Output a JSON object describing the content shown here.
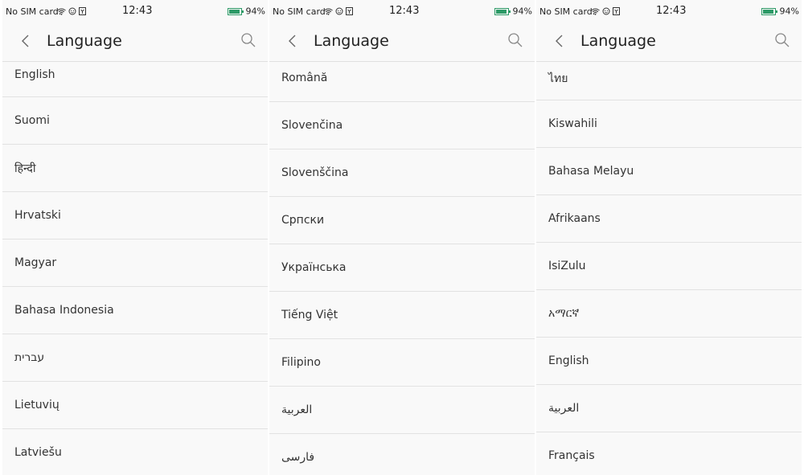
{
  "screens": [
    {
      "status": {
        "carrier": "No SIM card.",
        "time": "12:43",
        "battery_pct_label": "94%",
        "battery_level": 0.94
      },
      "header": {
        "title": "Language"
      },
      "languages": [
        "English",
        "Suomi",
        "हिन्दी",
        "Hrvatski",
        "Magyar",
        "Bahasa Indonesia",
        "עברית",
        "Lietuvių",
        "Latviešu"
      ]
    },
    {
      "status": {
        "carrier": "No SIM card.",
        "time": "12:43",
        "battery_pct_label": "94%",
        "battery_level": 0.94
      },
      "header": {
        "title": "Language"
      },
      "languages": [
        "Română",
        "Slovenčina",
        "Slovenščina",
        "Српски",
        "Українська",
        "Tiếng Việt",
        "Filipino",
        "العربية",
        "فارسی"
      ]
    },
    {
      "status": {
        "carrier": "No SIM card.",
        "time": "12:43",
        "battery_pct_label": "94%",
        "battery_level": 0.94
      },
      "header": {
        "title": "Language"
      },
      "languages": [
        "ไทย",
        "Kiswahili",
        "Bahasa Melayu",
        "Afrikaans",
        "IsiZulu",
        "አማርኛ",
        "English",
        "العربية",
        "Français"
      ]
    }
  ],
  "icons": {
    "wifi": "wifi-icon",
    "notification": "notification-icon",
    "storage": "storage-icon",
    "back": "back-chevron-icon",
    "search": "search-icon"
  },
  "colors": {
    "battery": "#2d9a67",
    "background": "#f9f9f9",
    "divider": "#e2e2e2"
  }
}
